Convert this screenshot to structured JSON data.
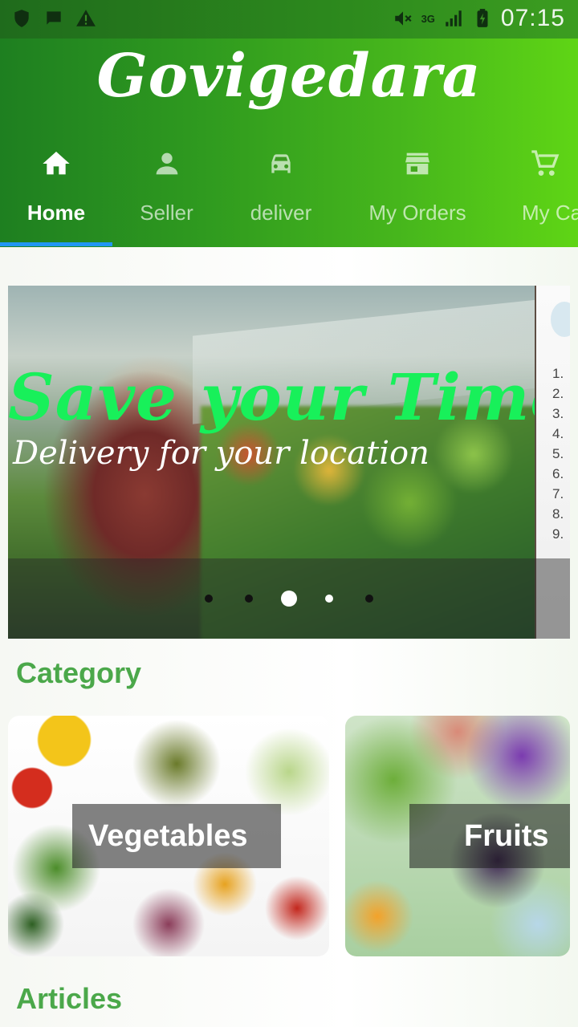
{
  "status_bar": {
    "time": "07:15",
    "network": "3G",
    "icons": [
      "shield-icon",
      "chat-bubble-icon",
      "warning-icon",
      "mute-icon",
      "signal-icon",
      "battery-charging-icon"
    ]
  },
  "app": {
    "title": "Govigedara",
    "theme_color": "#2f9a1f",
    "indicator_color": "#2196f3"
  },
  "tabs": [
    {
      "label": "Home",
      "icon": "home-icon",
      "active": true
    },
    {
      "label": "Seller",
      "icon": "person-icon",
      "active": false
    },
    {
      "label": "deliver",
      "icon": "car-icon",
      "active": false
    },
    {
      "label": "My Orders",
      "icon": "store-icon",
      "active": false
    },
    {
      "label": "My Ca",
      "icon": "cart-icon",
      "active": false
    }
  ],
  "banner": {
    "title": "Save your Time",
    "subtitle": "Delivery for your location",
    "slide_count": 5,
    "active_slide": 3,
    "peek_numbers": [
      "1.",
      "2.",
      "3.",
      "4.",
      "5.",
      "6.",
      "7.",
      "8.",
      "9."
    ]
  },
  "category": {
    "heading": "Category",
    "items": [
      {
        "label": "Vegetables"
      },
      {
        "label": "Fruits"
      }
    ]
  },
  "articles": {
    "heading": "Articles"
  }
}
